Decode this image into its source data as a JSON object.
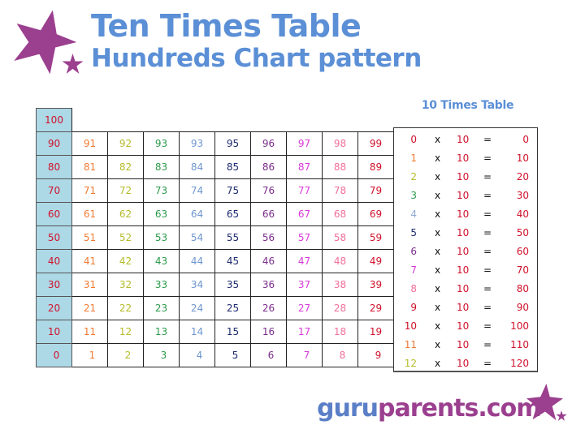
{
  "title": {
    "line1": "Ten Times Table",
    "line2": "Hundreds Chart pattern"
  },
  "colors": {
    "title": "#5b8fd6",
    "star": "#9b3f8f",
    "tens_bg": "#add8e6",
    "columns": [
      "#d0112b",
      "#ef7b33",
      "#b5bb2a",
      "#2c9a4b",
      "#6f97cf",
      "#1c2a6e",
      "#7b2d8b",
      "#d83ad8",
      "#ef6f9a",
      "#d0112b"
    ]
  },
  "hundreds_chart": {
    "top": "100",
    "rows": [
      [
        "90",
        "91",
        "92",
        "93",
        "93",
        "95",
        "96",
        "97",
        "98",
        "99"
      ],
      [
        "80",
        "81",
        "82",
        "83",
        "84",
        "85",
        "86",
        "87",
        "88",
        "89"
      ],
      [
        "70",
        "71",
        "72",
        "73",
        "74",
        "75",
        "76",
        "77",
        "78",
        "79"
      ],
      [
        "60",
        "61",
        "62",
        "63",
        "64",
        "65",
        "66",
        "67",
        "68",
        "69"
      ],
      [
        "50",
        "51",
        "52",
        "53",
        "54",
        "55",
        "56",
        "57",
        "58",
        "59"
      ],
      [
        "40",
        "41",
        "42",
        "43",
        "44",
        "45",
        "46",
        "47",
        "48",
        "49"
      ],
      [
        "30",
        "31",
        "32",
        "33",
        "34",
        "35",
        "36",
        "37",
        "38",
        "39"
      ],
      [
        "20",
        "21",
        "22",
        "23",
        "24",
        "25",
        "26",
        "27",
        "28",
        "29"
      ],
      [
        "10",
        "11",
        "12",
        "13",
        "14",
        "15",
        "16",
        "17",
        "18",
        "19"
      ],
      [
        "0",
        "1",
        "2",
        "3",
        "4",
        "5",
        "6",
        "7",
        "8",
        "9"
      ]
    ]
  },
  "times_table": {
    "heading": "10 Times Table",
    "operator": "x",
    "equals": "=",
    "multiplier": "10",
    "rows": [
      {
        "n": "0",
        "result": "0",
        "color": "#d0112b"
      },
      {
        "n": "1",
        "result": "10",
        "color": "#ef7b33"
      },
      {
        "n": "2",
        "result": "20",
        "color": "#b5bb2a"
      },
      {
        "n": "3",
        "result": "30",
        "color": "#2c9a4b"
      },
      {
        "n": "4",
        "result": "40",
        "color": "#8fa9d4"
      },
      {
        "n": "5",
        "result": "50",
        "color": "#1c2a6e"
      },
      {
        "n": "6",
        "result": "60",
        "color": "#7b2d8b"
      },
      {
        "n": "7",
        "result": "70",
        "color": "#d83ad8"
      },
      {
        "n": "8",
        "result": "80",
        "color": "#ef6f9a"
      },
      {
        "n": "9",
        "result": "90",
        "color": "#d0112b"
      },
      {
        "n": "10",
        "result": "100",
        "color": "#d0112b"
      },
      {
        "n": "11",
        "result": "110",
        "color": "#ef7b33"
      },
      {
        "n": "12",
        "result": "120",
        "color": "#b5bb2a"
      }
    ]
  },
  "logo": {
    "part1": "guru",
    "part2": "parents.com",
    "part1_color": "#5b7fc7",
    "part2_color": "#9b3f8f"
  }
}
